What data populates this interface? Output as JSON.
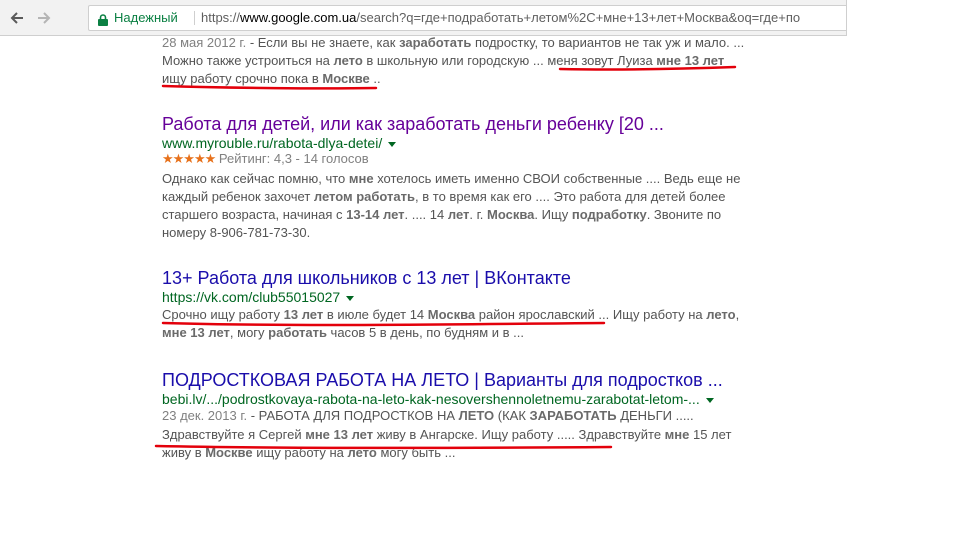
{
  "browser": {
    "security_label": "Надежный",
    "url_scheme": "https://",
    "url_host": "www.google.com.ua",
    "url_path": "/search?q=где+подработать+летом%2C+мне+13+лет+Москва&oq=где+по"
  },
  "results": {
    "top_snippet": {
      "line1_date": "28 мая 2012 г.",
      "line1_a": " - Если вы не знаете, как ",
      "line1_b1": "заработать",
      "line1_c": " подростку, то вариантов не так уж и мало. ...",
      "line2_a": "Можно также устроиться на ",
      "line2_b1": "лето",
      "line2_c": " в школьную или городскую ... меня зовут Луиза ",
      "line2_b2": "мне 13 лет",
      "line3_a": "ищу работу срочно пока в ",
      "line3_b1": "Москве",
      "line3_c": " .."
    },
    "r1": {
      "title": "Работа для детей, или как заработать деньги ребенку [20 ...",
      "url": "www.myrouble.ru/rabota-dlya-detei/",
      "stars": "★★★★★",
      "rating": "Рейтинг: 4,3 - 14 голосов",
      "s1_a": "Однако как сейчас помню, что ",
      "s1_b1": "мне",
      "s1_c": " хотелось иметь именно СВОИ собственные .... Ведь еще не",
      "s2_a": "каждый ребенок захочет ",
      "s2_b1": "летом работать",
      "s2_c": ", в то время как его .... Это работа для детей более",
      "s3_a": "старшего возраста, начиная с ",
      "s3_b1": "13",
      "s3_b": "-",
      "s3_b2": "14 лет",
      "s3_c": ". .... 14 ",
      "s3_b3": "лет",
      "s3_d": ". г. ",
      "s3_b4": "Москва",
      "s3_e": ". Ищу ",
      "s3_b5": "подработку",
      "s3_f": ". Звоните по",
      "s4": "номеру 8-906-781-73-30."
    },
    "r2": {
      "title": "13+ Работа для школьников с 13 лет | ВКонтакте",
      "url": "https://vk.com/club55015027",
      "s1_a": "Срочно ищу работу ",
      "s1_b1": "13 лет",
      "s1_c": " в июле будет 14 ",
      "s1_b2": "Москва",
      "s1_d": " район ярославский ... Ищу работу на ",
      "s1_b3": "лето",
      "s1_e": ",",
      "s2_b1": "мне 13 лет",
      "s2_a": ", могу ",
      "s2_b2": "работать",
      "s2_c": " часов 5 в день, по будням и в ..."
    },
    "r3": {
      "title": "ПОДРОСТКОВАЯ РАБОТА НА ЛЕТО | Варианты для подростков ...",
      "url": "bebi.lv/.../podrostkovaya-rabota-na-leto-kak-nesovershennoletnemu-zarabotat-letom-...",
      "s1_date": "23 дек. 2013 г.",
      "s1_a": " - РАБОТА ДЛЯ ПОДРОСТКОВ НА ",
      "s1_b1": "ЛЕТО",
      "s1_c": " (КАК ",
      "s1_b2": "ЗАРАБОТАТЬ",
      "s1_d": " ДЕНЬГИ .....",
      "s2_a": "Здравствуйте я Сергей ",
      "s2_b1": "мне 13 лет",
      "s2_c": " живу в Ангарске. Ищу работу ..... Здравствуйте ",
      "s2_b2": "мне",
      "s2_d": " 15 лет",
      "s3_a": "живу в ",
      "s3_b1": "Москве",
      "s3_c": " ищу работу на ",
      "s3_b2": "лето",
      "s3_d": " могу быть ..."
    }
  },
  "colors": {
    "visited_title": "#660099",
    "link_title": "#1a0dab",
    "url_green": "#006621",
    "snippet_text": "#545454",
    "annotation_red": "#e3000b",
    "star_orange": "#e7711b"
  },
  "icons": [
    "back-arrow-icon",
    "forward-arrow-icon",
    "lock-icon",
    "dropdown-arrow-icon",
    "star-rating-icon"
  ]
}
